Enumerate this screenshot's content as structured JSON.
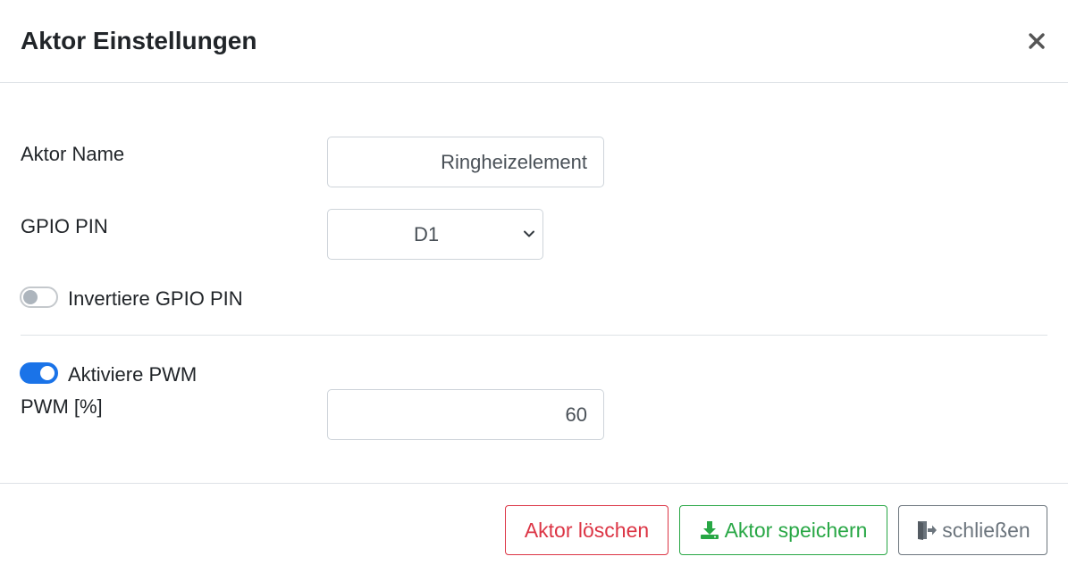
{
  "modal": {
    "title": "Aktor Einstellungen",
    "close_icon": "close-icon"
  },
  "form": {
    "name": {
      "label": "Aktor Name",
      "value": "Ringheizelement"
    },
    "gpio": {
      "label": "GPIO PIN",
      "selected": "D1"
    },
    "invert": {
      "label": "Invertiere GPIO PIN",
      "checked": false
    },
    "pwm_toggle": {
      "label": "Aktiviere PWM",
      "checked": true
    },
    "pwm_value": {
      "label": "PWM [%]",
      "value": "60"
    }
  },
  "footer": {
    "delete_label": "Aktor löschen",
    "save_label": "Aktor speichern",
    "save_icon": "download-icon",
    "close_label": "schließen",
    "close_icon": "exit-door-icon"
  },
  "colors": {
    "danger": "#dc3545",
    "success": "#28a745",
    "secondary": "#6c757d",
    "toggle_on": "#1a73e8"
  }
}
